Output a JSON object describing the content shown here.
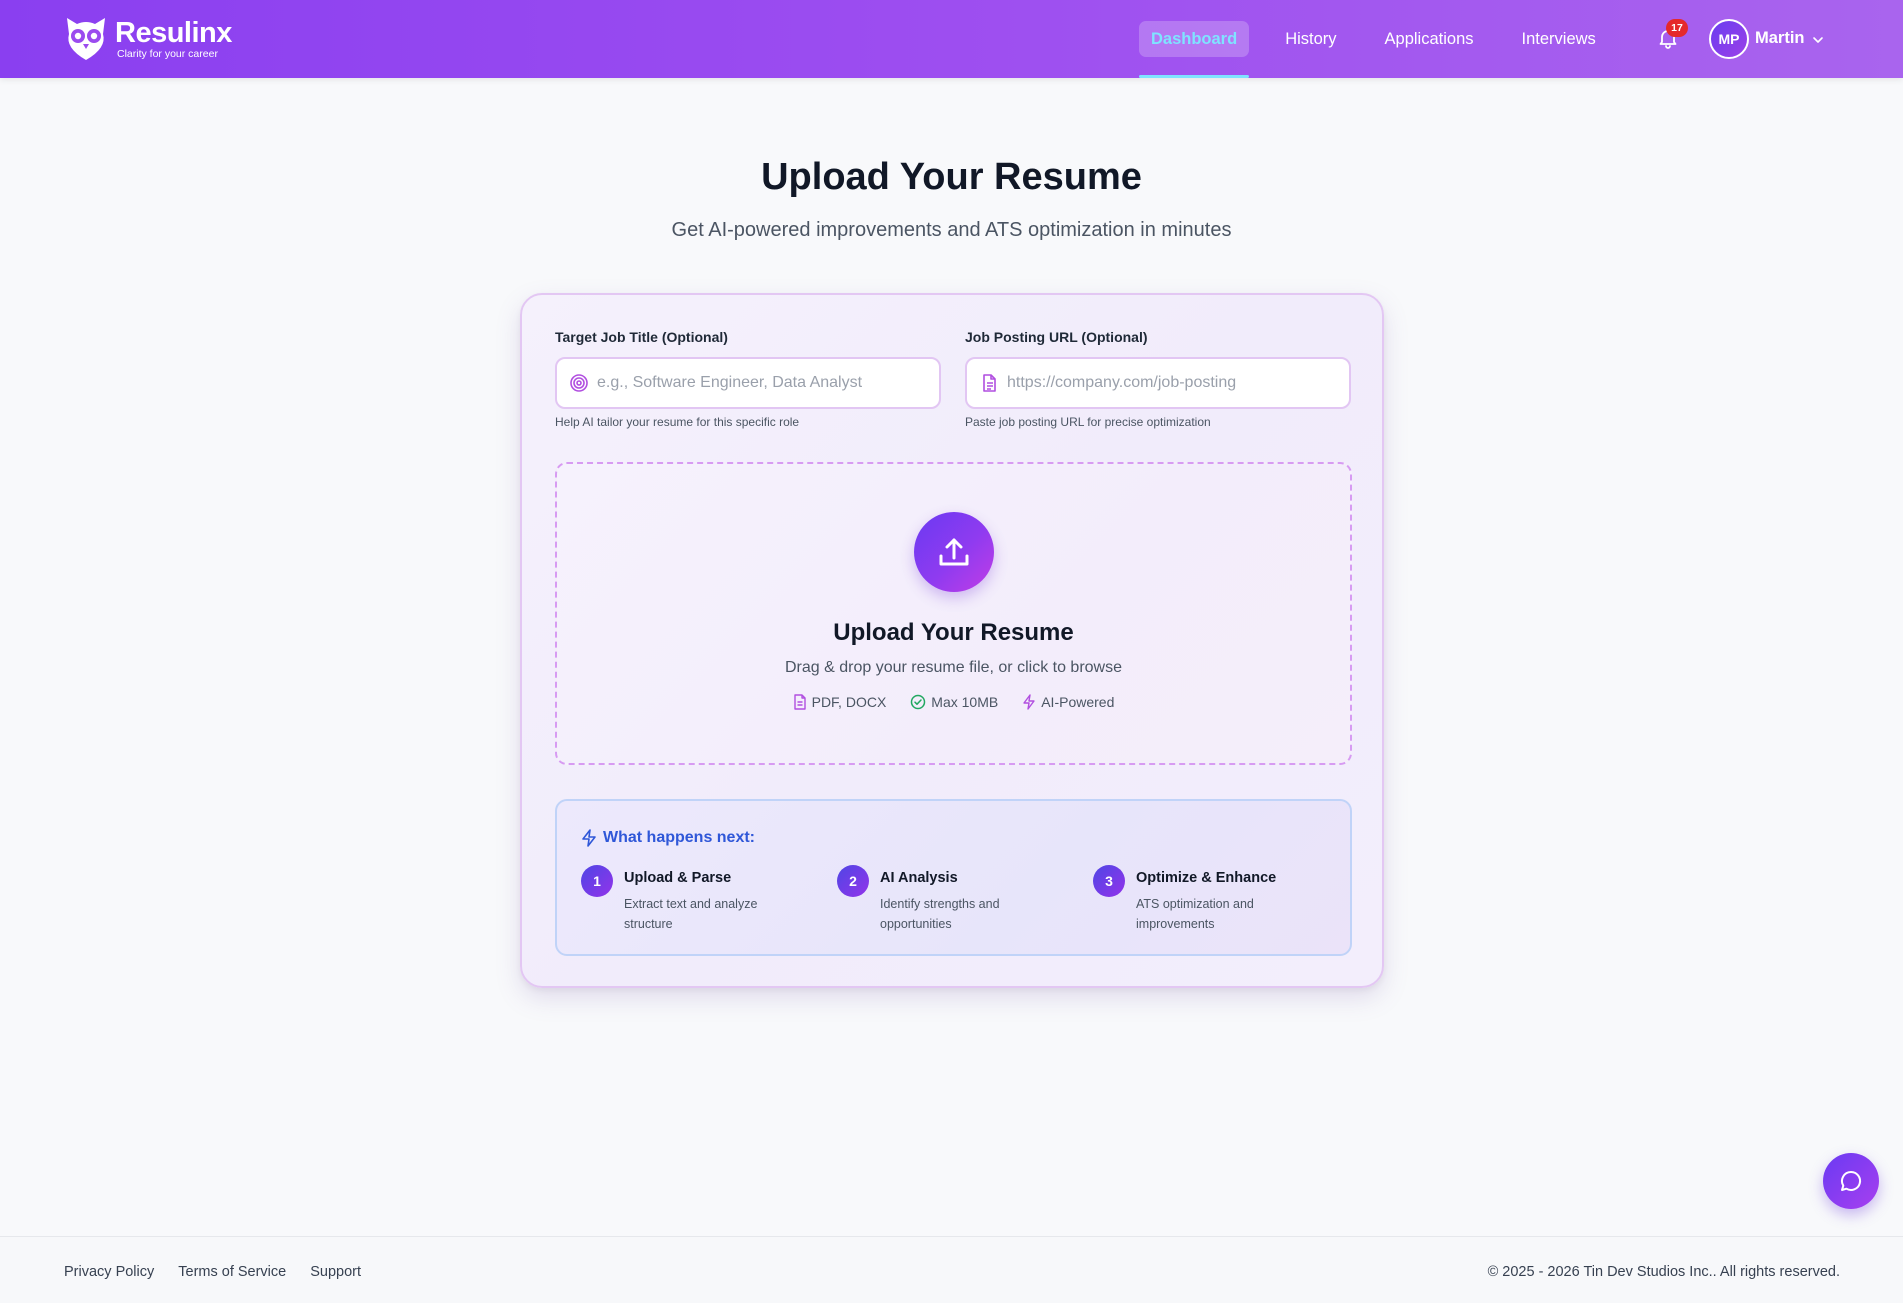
{
  "header": {
    "brand": "Resulinx",
    "tagline": "Clarity for your career",
    "nav": [
      {
        "label": "Dashboard",
        "active": true
      },
      {
        "label": "History"
      },
      {
        "label": "Applications"
      },
      {
        "label": "Interviews"
      }
    ],
    "notification_count": "17",
    "user": {
      "initials": "MP",
      "name": "Martin"
    }
  },
  "hero": {
    "title": "Upload Your Resume",
    "subtitle": "Get AI-powered improvements and ATS optimization in minutes"
  },
  "form": {
    "job_title": {
      "label": "Target Job Title (Optional)",
      "placeholder": "e.g., Software Engineer, Data Analyst",
      "value": "",
      "help": "Help AI tailor your resume for this specific role",
      "icon": "target-icon"
    },
    "job_url": {
      "label": "Job Posting URL (Optional)",
      "placeholder": "https://company.com/job-posting",
      "value": "",
      "help": "Paste job posting URL for precise optimization",
      "icon": "document-icon"
    }
  },
  "dropzone": {
    "title": "Upload Your Resume",
    "subtitle": "Drag & drop your resume file, or click to browse",
    "meta": [
      {
        "label": "PDF, DOCX",
        "icon": "file-icon"
      },
      {
        "label": "Max 10MB",
        "icon": "check-circle-icon"
      },
      {
        "label": "AI-Powered",
        "icon": "lightning-icon"
      }
    ]
  },
  "next": {
    "title": "What happens next:",
    "steps": [
      {
        "num": "1",
        "title": "Upload & Parse",
        "desc": "Extract text and analyze structure"
      },
      {
        "num": "2",
        "title": "AI Analysis",
        "desc": "Identify strengths and opportunities"
      },
      {
        "num": "3",
        "title": "Optimize & Enhance",
        "desc": "ATS optimization and improvements"
      }
    ]
  },
  "footer": {
    "links": [
      "Privacy Policy",
      "Terms of Service",
      "Support"
    ],
    "copyright": "© 2025 - 2026 Tin Dev Studios Inc.. All rights reserved."
  },
  "colors": {
    "header_gradient_start": "#8a3ff0",
    "header_gradient_end": "#a964ee",
    "active_nav": "#7fe3ff",
    "accent_purple": "#8f3bf0",
    "badge_red": "#e5292b",
    "next_title_blue": "#2f57d8"
  }
}
